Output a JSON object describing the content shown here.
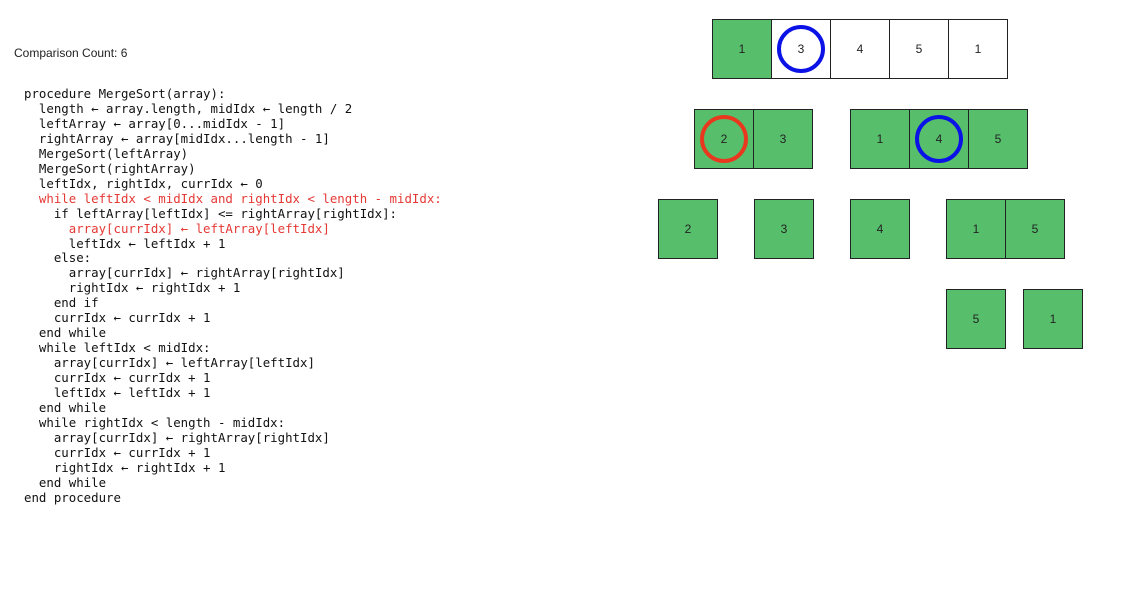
{
  "status": {
    "comparison_label": "Comparison Count: 6"
  },
  "code": {
    "lines": [
      {
        "text": "procedure MergeSort(array):",
        "indent": 0,
        "highlight": false
      },
      {
        "text": "length ← array.length, midIdx ← length / 2",
        "indent": 1,
        "highlight": false
      },
      {
        "text": "leftArray ← array[0...midIdx - 1]",
        "indent": 1,
        "highlight": false
      },
      {
        "text": "rightArray ← array[midIdx...length - 1]",
        "indent": 1,
        "highlight": false
      },
      {
        "text": "MergeSort(leftArray)",
        "indent": 1,
        "highlight": false
      },
      {
        "text": "MergeSort(rightArray)",
        "indent": 1,
        "highlight": false
      },
      {
        "text": "leftIdx, rightIdx, currIdx ← 0",
        "indent": 1,
        "highlight": false
      },
      {
        "text": "while leftIdx < midIdx and rightIdx < length - midIdx:",
        "indent": 1,
        "highlight": true
      },
      {
        "text": "if leftArray[leftIdx] <= rightArray[rightIdx]:",
        "indent": 2,
        "highlight": false
      },
      {
        "text": "array[currIdx] ← leftArray[leftIdx]",
        "indent": 3,
        "highlight": true
      },
      {
        "text": "leftIdx ← leftIdx + 1",
        "indent": 3,
        "highlight": false
      },
      {
        "text": "else:",
        "indent": 2,
        "highlight": false
      },
      {
        "text": "array[currIdx] ← rightArray[rightIdx]",
        "indent": 3,
        "highlight": false
      },
      {
        "text": "rightIdx ← rightIdx + 1",
        "indent": 3,
        "highlight": false
      },
      {
        "text": "end if",
        "indent": 2,
        "highlight": false
      },
      {
        "text": "currIdx ← currIdx + 1",
        "indent": 2,
        "highlight": false
      },
      {
        "text": "end while",
        "indent": 1,
        "highlight": false
      },
      {
        "text": "while leftIdx < midIdx:",
        "indent": 1,
        "highlight": false
      },
      {
        "text": "array[currIdx] ← leftArray[leftIdx]",
        "indent": 2,
        "highlight": false
      },
      {
        "text": "currIdx ← currIdx + 1",
        "indent": 2,
        "highlight": false
      },
      {
        "text": "leftIdx ← leftIdx + 1",
        "indent": 2,
        "highlight": false
      },
      {
        "text": "end while",
        "indent": 1,
        "highlight": false
      },
      {
        "text": "while rightIdx < length - midIdx:",
        "indent": 1,
        "highlight": false
      },
      {
        "text": "array[currIdx] ← rightArray[rightIdx]",
        "indent": 2,
        "highlight": false
      },
      {
        "text": "currIdx ← currIdx + 1",
        "indent": 2,
        "highlight": false
      },
      {
        "text": "rightIdx ← rightIdx + 1",
        "indent": 2,
        "highlight": false
      },
      {
        "text": "end while",
        "indent": 1,
        "highlight": false
      },
      {
        "text": "end procedure",
        "indent": 0,
        "highlight": false
      }
    ]
  },
  "colors": {
    "sorted_fill": "#57bf6c",
    "unsorted_fill": "#ffffff",
    "highlight_text": "#e53935",
    "pointer_blue": "#0b12e6",
    "pointer_red": "#e8391e"
  },
  "tree": {
    "arrays": [
      {
        "id": "root",
        "level": 0,
        "cells": [
          {
            "value": "1",
            "sorted": true,
            "marker": null
          },
          {
            "value": "3",
            "sorted": false,
            "marker": "blue"
          },
          {
            "value": "4",
            "sorted": false,
            "marker": null
          },
          {
            "value": "5",
            "sorted": false,
            "marker": null
          },
          {
            "value": "1",
            "sorted": false,
            "marker": null
          }
        ]
      },
      {
        "id": "left",
        "level": 1,
        "cells": [
          {
            "value": "2",
            "sorted": true,
            "marker": "red"
          },
          {
            "value": "3",
            "sorted": true,
            "marker": null
          }
        ]
      },
      {
        "id": "right",
        "level": 1,
        "cells": [
          {
            "value": "1",
            "sorted": true,
            "marker": null
          },
          {
            "value": "4",
            "sorted": true,
            "marker": "blue"
          },
          {
            "value": "5",
            "sorted": true,
            "marker": null
          }
        ]
      },
      {
        "id": "left-left",
        "level": 2,
        "cells": [
          {
            "value": "2",
            "sorted": true,
            "marker": null
          }
        ]
      },
      {
        "id": "left-right",
        "level": 2,
        "cells": [
          {
            "value": "3",
            "sorted": true,
            "marker": null
          }
        ]
      },
      {
        "id": "right-left",
        "level": 2,
        "cells": [
          {
            "value": "4",
            "sorted": true,
            "marker": null
          }
        ]
      },
      {
        "id": "right-right",
        "level": 2,
        "cells": [
          {
            "value": "1",
            "sorted": true,
            "marker": null
          },
          {
            "value": "5",
            "sorted": true,
            "marker": null
          }
        ]
      },
      {
        "id": "right-right-left",
        "level": 3,
        "cells": [
          {
            "value": "5",
            "sorted": true,
            "marker": null
          }
        ]
      },
      {
        "id": "right-right-right",
        "level": 3,
        "cells": [
          {
            "value": "1",
            "sorted": true,
            "marker": null
          }
        ]
      }
    ]
  }
}
